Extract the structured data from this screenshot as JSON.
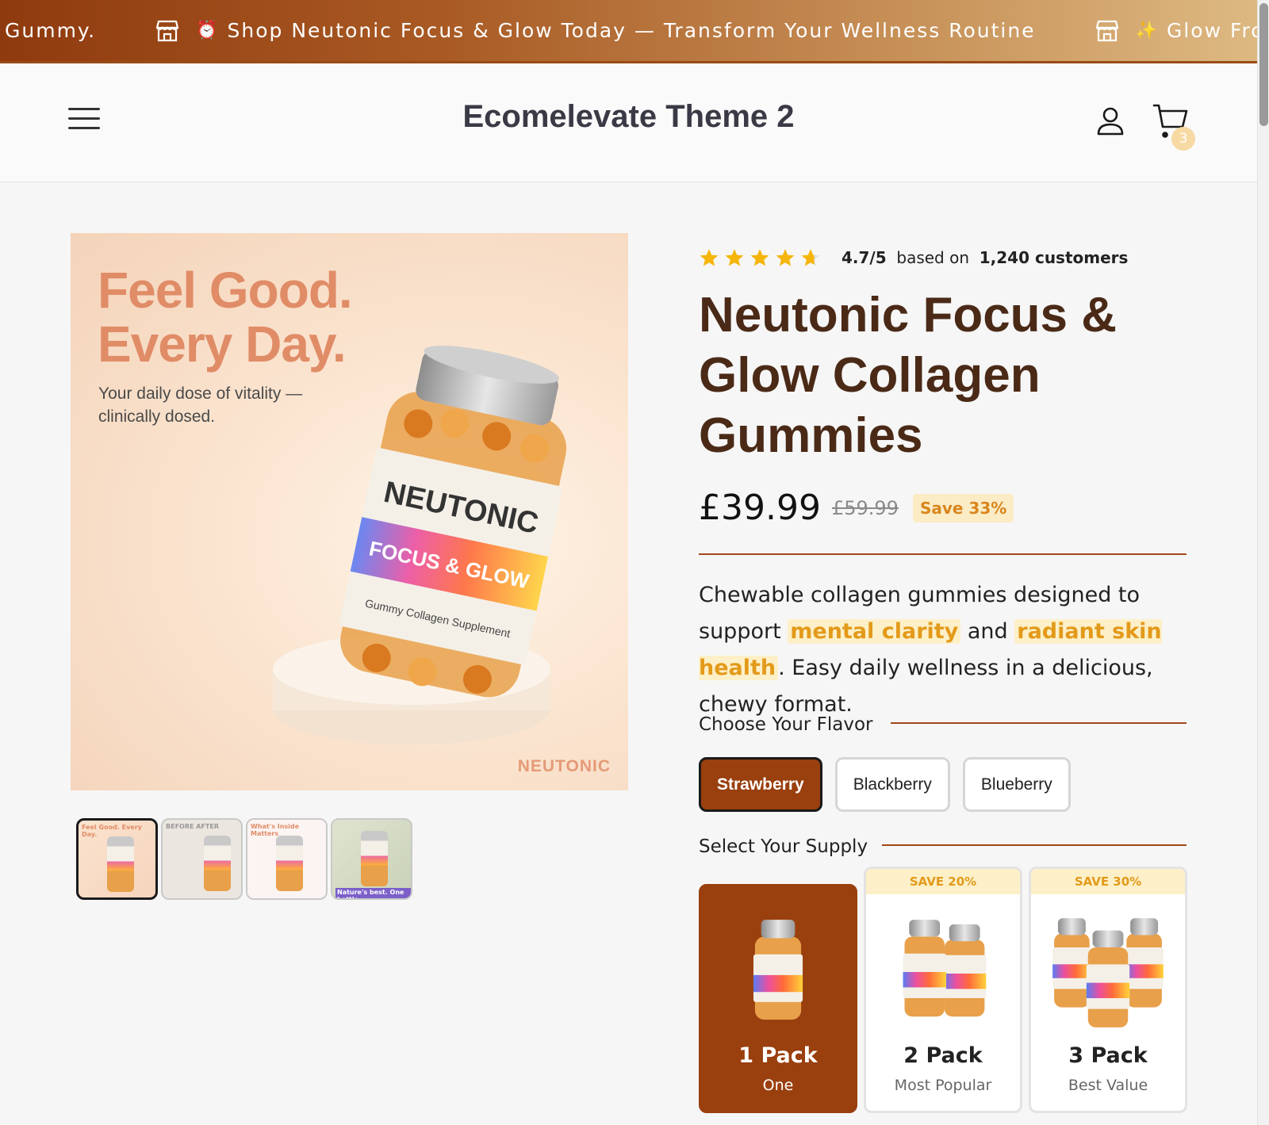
{
  "announcement": {
    "items": [
      {
        "emoji": "",
        "text": "Gummy."
      },
      {
        "emoji": "⏰",
        "text": "Shop Neutonic Focus & Glow Today — Transform Your Wellness Routine"
      },
      {
        "emoji": "✨",
        "text": "Glow From With"
      }
    ]
  },
  "header": {
    "logo": "Ecomelevate Theme 2",
    "cart_count": "3"
  },
  "hero": {
    "headline_line1": "Feel Good.",
    "headline_line2": "Every Day.",
    "subtext": "Your daily dose of vitality — clinically dosed.",
    "jar_brand": "NEUTONIC",
    "jar_product": "FOCUS & GLOW",
    "jar_type": "Gummy Collagen Supplement",
    "corner_brand": "NEUTONIC"
  },
  "thumbnails": [
    {
      "label": "Feel Good. Every Day.",
      "active": true
    },
    {
      "label": "BEFORE   AFTER",
      "active": false
    },
    {
      "label": "What's Inside Matters",
      "active": false
    },
    {
      "label": "Nature's best. One bottle.",
      "active": false
    }
  ],
  "product": {
    "rating_value": "4.7/5",
    "rating_based": "based on",
    "rating_count": "1,240 customers",
    "rating_stars": 4.7,
    "title": "Neutonic Focus & Glow Collagen Gummies",
    "price": "£39.99",
    "compare_price": "£59.99",
    "save_label": "Save 33%",
    "desc_part1": "Chewable collagen gummies designed to support",
    "desc_hl1": "mental clarity",
    "desc_and": "and",
    "desc_hl2": "radiant skin health",
    "desc_part2": ". Easy daily wellness in a delicious, chewy format."
  },
  "flavor": {
    "label": "Choose Your Flavor",
    "options": [
      "Strawberry",
      "Blackberry",
      "Blueberry"
    ],
    "selected": "Strawberry"
  },
  "supply": {
    "label": "Select Your Supply",
    "packs": [
      {
        "name": "1 Pack",
        "sub": "One",
        "badge": "",
        "selected": true
      },
      {
        "name": "2 Pack",
        "sub": "Most Popular",
        "badge": "SAVE 20%",
        "selected": false
      },
      {
        "name": "3 Pack",
        "sub": "Best Value",
        "badge": "SAVE 30%",
        "selected": false
      }
    ]
  },
  "colors": {
    "brand": "#9a3f0e",
    "title": "#4a2a17",
    "highlight_bg": "#fdf0c8",
    "highlight_text": "#e39a1a"
  }
}
